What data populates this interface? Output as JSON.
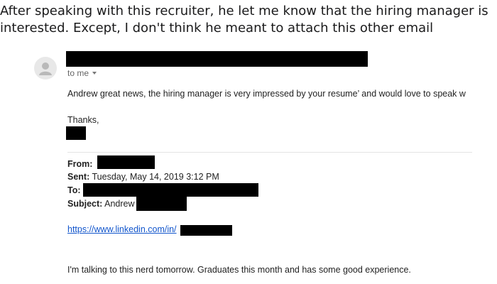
{
  "post_caption": {
    "line1": "After speaking with this recruiter, he let me know that the hiring manager is",
    "line2": "interested. Except, I don't think he meant to attach this other email"
  },
  "email": {
    "recipient_label": "to me",
    "body_line": "Andrew great news, the hiring manager is very impressed by your resume’ and would love to speak w",
    "signoff": "Thanks,",
    "forwarded": {
      "from_label": "From:",
      "sent_label": "Sent:",
      "sent_value": "Tuesday, May 14, 2019 3:12 PM",
      "to_label": "To:",
      "subject_label": "Subject:",
      "subject_value": "Andrew"
    },
    "link_text": "https://www.linkedin.com/in/",
    "footer_text": "I'm talking to this nerd tomorrow. Graduates this month and has some good experience."
  },
  "icons": {
    "avatar": "default-avatar-icon",
    "dropdown": "chevron-down-icon"
  },
  "colors": {
    "redaction": "#000000",
    "link": "#1155cc",
    "muted_text": "#666666"
  }
}
